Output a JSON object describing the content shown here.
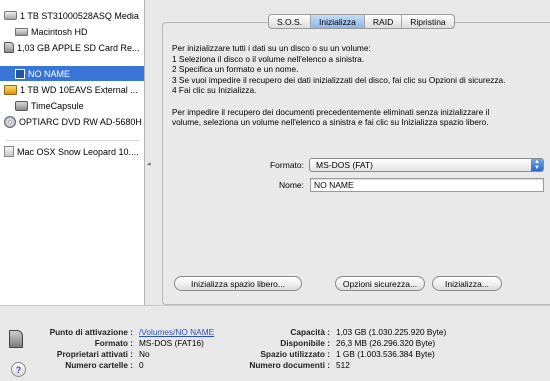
{
  "sidebar": {
    "items": [
      {
        "label": "1 TB ST31000528ASQ Media",
        "icon": "hard-disk-icon"
      },
      {
        "label": "Macintosh HD",
        "icon": "volume-icon"
      },
      {
        "label": "1,03 GB APPLE SD Card Re...",
        "icon": "sd-card-icon"
      },
      {
        "label": "NO NAME",
        "icon": "sd-volume-icon"
      },
      {
        "label": "1 TB WD 10EAVS External ...",
        "icon": "external-disk-icon"
      },
      {
        "label": "TimeCapsule",
        "icon": "time-capsule-icon"
      },
      {
        "label": "OPTIARC DVD RW AD-5680H",
        "icon": "dvd-icon"
      },
      {
        "label": "Mac OSX Snow Leopard 10....",
        "icon": "disk-image-icon"
      }
    ]
  },
  "tabs": [
    "S.O.S.",
    "Inizializza",
    "RAID",
    "Ripristina"
  ],
  "active_tab": "Inizializza",
  "instructions": {
    "line1": "Per inizializzare tutti i dati su un disco o su un volume:",
    "line2": "1  Seleziona il disco o il volume nell'elenco a sinistra.",
    "line3": "2  Specifica un formato e un nome.",
    "line4": "3  Se vuoi impedire il recupero dei dati inizializzati del disco, fai clic su Opzioni di sicurezza.",
    "line5": "4  Fai clic su Inizializza.",
    "line6": "Per impedire il recupero dei documenti precedentemente eliminati senza inizializzare il",
    "line7": "volume, seleziona un volume nell'elenco a sinistra e fai clic su Inizializza spazio libero."
  },
  "form": {
    "format_label": "Formato:",
    "format_value": "MS-DOS (FAT)",
    "name_label": "Nome:",
    "name_value": "NO NAME"
  },
  "buttons": {
    "erase_free_space": "Inizializza spazio libero...",
    "security_options": "Opzioni sicurezza...",
    "erase": "Inizializza..."
  },
  "details": {
    "mount_point_label": "Punto di attivazione :",
    "mount_point_value": "/Volumes/NO NAME",
    "format_label": "Formato :",
    "format_value": "MS-DOS (FAT16)",
    "owners_label": "Proprietari attivati :",
    "owners_value": "No",
    "folders_label": "Numero cartelle :",
    "folders_value": "0",
    "capacity_label": "Capacità :",
    "capacity_value": "1,03 GB (1.030.225.920 Byte)",
    "available_label": "Disponibile :",
    "available_value": "26,3 MB (26.296.320 Byte)",
    "used_label": "Spazio utilizzato :",
    "used_value": "1 GB (1.003.536.384 Byte)",
    "files_label": "Numero documenti :",
    "files_value": "512"
  }
}
